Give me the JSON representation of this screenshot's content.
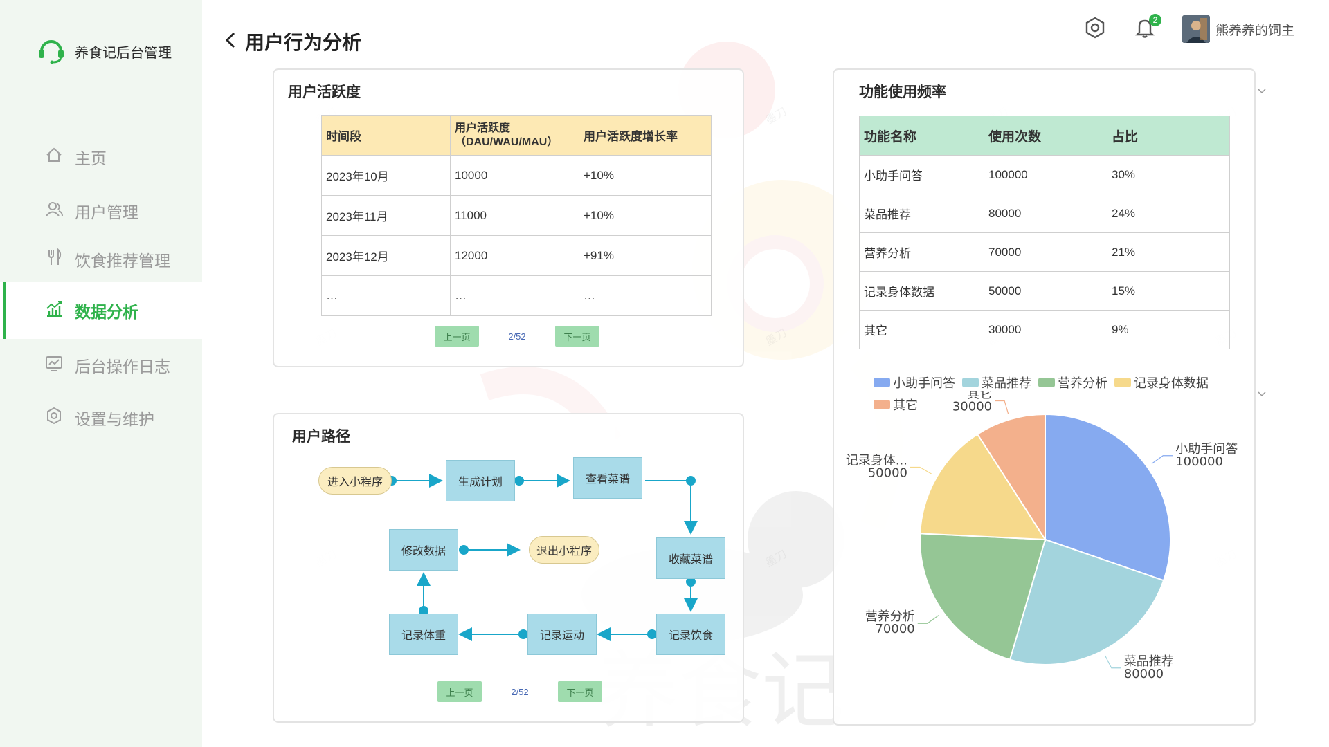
{
  "app": {
    "brand": "养食记后台管理"
  },
  "sidebar": {
    "items": [
      {
        "label": "主页",
        "icon": "home-icon",
        "active": false
      },
      {
        "label": "用户管理",
        "icon": "users-icon",
        "active": false
      },
      {
        "label": "饮食推荐管理",
        "icon": "utensils-icon",
        "active": false
      },
      {
        "label": "数据分析",
        "icon": "chart-icon",
        "active": true
      },
      {
        "label": "后台操作日志",
        "icon": "log-icon",
        "active": false
      },
      {
        "label": "设置与维护",
        "icon": "gear-icon",
        "active": false
      }
    ]
  },
  "header": {
    "title": "用户行为分析",
    "notification_count": "2",
    "user_name": "熊养养的饲主"
  },
  "activity": {
    "title": "用户活跃度",
    "columns": [
      "时间段",
      "用户活跃度（DAU/WAU/MAU）",
      "用户活跃度增长率"
    ],
    "rows": [
      [
        "2023年10月",
        "10000",
        "+10%"
      ],
      [
        "2023年11月",
        "11000",
        "+10%"
      ],
      [
        "2023年12月",
        "12000",
        "+91%"
      ],
      [
        "…",
        "…",
        "…"
      ]
    ],
    "pager": {
      "prev": "上一页",
      "page": "2/52",
      "next": "下一页"
    }
  },
  "path": {
    "title": "用户路径",
    "nodes": {
      "enter": "进入小程序",
      "plan": "生成计划",
      "view": "查看菜谱",
      "collect": "收藏菜谱",
      "diet": "记录饮食",
      "exercise": "记录运动",
      "weight": "记录体重",
      "modify": "修改数据",
      "exit": "退出小程序"
    },
    "pager": {
      "prev": "上一页",
      "page": "2/52",
      "next": "下一页"
    }
  },
  "frequency": {
    "title": "功能使用频率",
    "columns": [
      "功能名称",
      "使用次数",
      "占比"
    ],
    "rows": [
      [
        "小助手问答",
        "100000",
        "30%"
      ],
      [
        "菜品推荐",
        "80000",
        "24%"
      ],
      [
        "营养分析",
        "70000",
        "21%"
      ],
      [
        "记录身体数据",
        "50000",
        "15%"
      ],
      [
        "其它",
        "30000",
        "9%"
      ]
    ]
  },
  "chart_data": {
    "type": "pie",
    "legend_position": "top",
    "slices": [
      {
        "name": "小助手问答",
        "label": "小助手问答",
        "value": 100000,
        "color": "#86aaf0"
      },
      {
        "name": "菜品推荐",
        "label": "菜品推荐",
        "value": 80000,
        "color": "#a3d4dd"
      },
      {
        "name": "营养分析",
        "label": "营养分析",
        "value": 70000,
        "color": "#95c695"
      },
      {
        "name": "记录身体数据",
        "label": "记录身体...",
        "value": 50000,
        "color": "#f6d98b"
      },
      {
        "name": "其它",
        "label": "其它",
        "value": 30000,
        "color": "#f3b08c"
      }
    ]
  },
  "colors": {
    "accent": "#2fb24b",
    "table_header_yellow": "#fde9b4",
    "table_header_green": "#bfe9d2"
  }
}
